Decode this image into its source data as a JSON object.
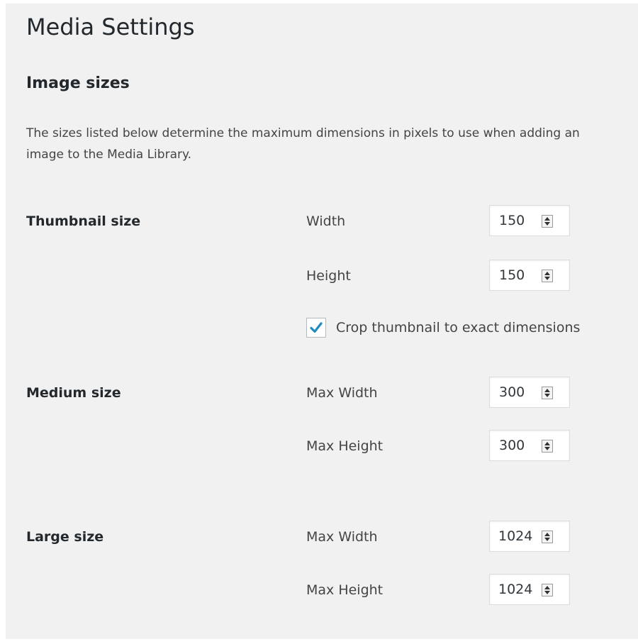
{
  "page": {
    "title": "Media Settings"
  },
  "image_sizes": {
    "heading": "Image sizes",
    "description": "The sizes listed below determine the maximum dimensions in pixels to use when adding an image to the Media Library.",
    "thumbnail": {
      "label": "Thumbnail size",
      "width_label": "Width",
      "width_value": "150",
      "height_label": "Height",
      "height_value": "150",
      "crop_checked": true,
      "crop_label": "Crop thumbnail to exact dimensions"
    },
    "medium": {
      "label": "Medium size",
      "width_label": "Max Width",
      "width_value": "300",
      "height_label": "Max Height",
      "height_value": "300"
    },
    "large": {
      "label": "Large size",
      "width_label": "Max Width",
      "width_value": "1024",
      "height_label": "Max Height",
      "height_value": "1024"
    }
  },
  "icons": {
    "spinner": "spin-up-down-icon",
    "checkbox": "checkmark-icon"
  },
  "colors": {
    "background": "#f1f1f1",
    "accent": "#1e8cbe",
    "text": "#23282d"
  }
}
